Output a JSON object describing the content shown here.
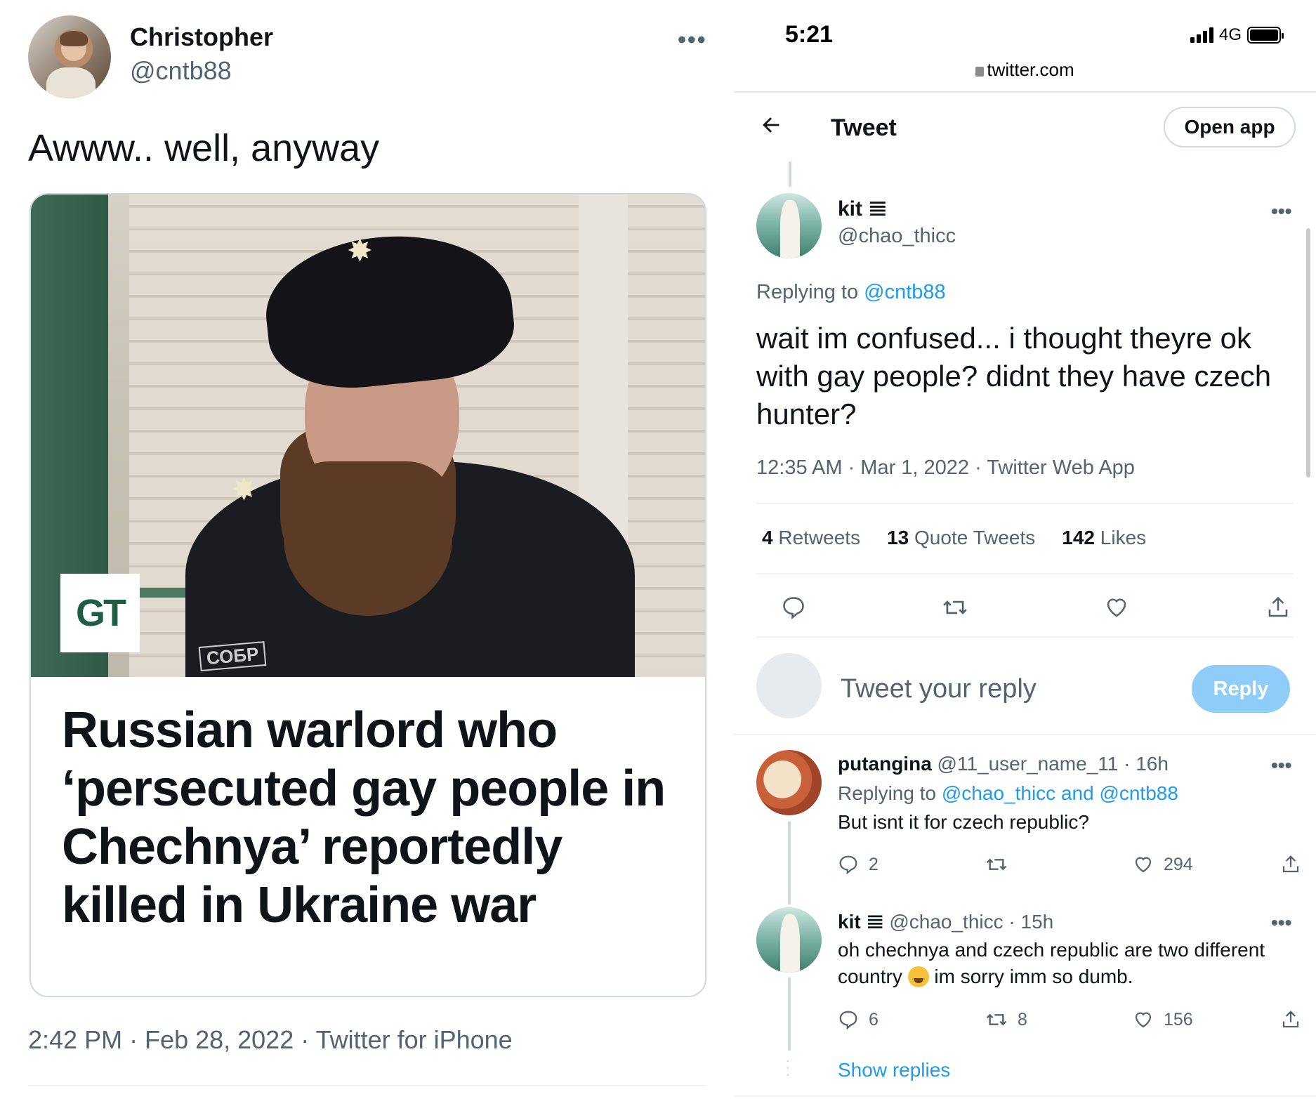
{
  "left": {
    "author_name": "Christopher",
    "author_handle": "@cntb88",
    "menu_icon": "more-dots-icon",
    "tweet_text": "Awww.. well, anyway",
    "card": {
      "logo_text": "GT",
      "patch_text": "СОБР",
      "headline": "Russian warlord who ‘persecuted gay people in Chechnya’ reportedly killed in Ukraine war"
    },
    "timestamp": "2:42 PM · Feb 28, 2022 · Twitter for iPhone"
  },
  "right": {
    "status_time": "5:21",
    "network": "4G",
    "url": "twitter.com",
    "header": {
      "back_icon": "arrow-left-icon",
      "title": "Tweet",
      "open_app": "Open app"
    },
    "main_tweet": {
      "name": "kit 𝌆",
      "handle": "@chao_thicc",
      "replying_prefix": "Replying to ",
      "replying_to": "@cntb88",
      "text": "wait im confused... i thought theyre ok with gay people? didnt they have czech hunter?",
      "timestamp": "12:35 AM · Mar 1, 2022 · Twitter Web App",
      "retweets": "4",
      "retweets_label": "Retweets",
      "quotes": "13",
      "quotes_label": "Quote Tweets",
      "likes": "142",
      "likes_label": "Likes"
    },
    "reply_box": {
      "placeholder": "Tweet your reply",
      "button": "Reply"
    },
    "replies": [
      {
        "name": "putangina",
        "meta": "@11_user_name_11 · 16h",
        "replying_prefix": "Replying to ",
        "replying_to": "@chao_thicc and @cntb88",
        "text": "But isnt it for czech republic?",
        "reply_count": "2",
        "retweet_count": "",
        "like_count": "294"
      },
      {
        "name": "kit 𝌆",
        "meta": "@chao_thicc · 15h",
        "text_a": "oh chechnya and czech republic are two different country",
        "text_b": " im sorry imm so dumb.",
        "reply_count": "6",
        "retweet_count": "8",
        "like_count": "156"
      }
    ],
    "show_replies": "Show replies"
  },
  "colors": {
    "accent": "#1d9bf0",
    "muted": "#536471",
    "reply_btn": "#8ecdf8",
    "text": "#0f1419"
  }
}
